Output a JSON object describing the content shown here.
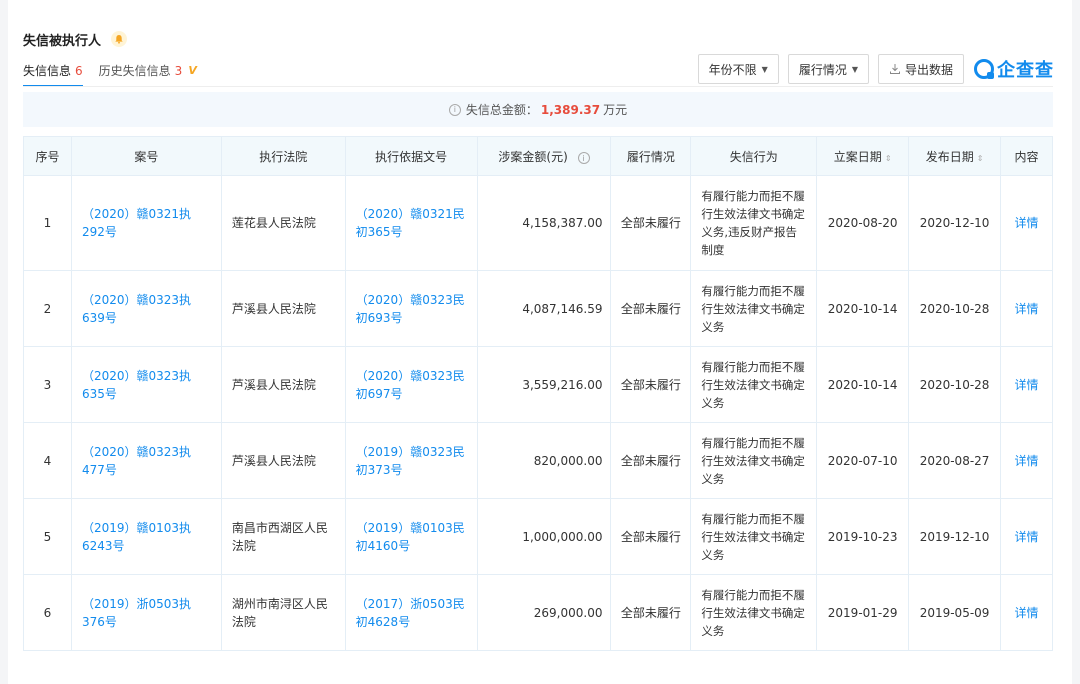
{
  "section": {
    "title": "失信被执行人"
  },
  "tabs": [
    {
      "label": "失信信息",
      "count": "6"
    },
    {
      "label": "历史失信信息",
      "count": "3",
      "badge": "V"
    }
  ],
  "toolbar": {
    "year_filter": "年份不限",
    "status_filter": "履行情况",
    "export_label": "导出数据",
    "logo_text": "企查查"
  },
  "summary": {
    "label": "失信总金额：",
    "amount": "1,389.37",
    "unit": "万元"
  },
  "table": {
    "headers": [
      "序号",
      "案号",
      "执行法院",
      "执行依据文号",
      "涉案金额(元)",
      "履行情况",
      "失信行为",
      "立案日期",
      "发布日期",
      "内容"
    ],
    "rows": [
      {
        "no": "1",
        "case": "（2020）赣0321执292号",
        "court": "莲花县人民法院",
        "basis": "（2020）赣0321民初365号",
        "amount": "4,158,387.00",
        "status": "全部未履行",
        "behavior": "有履行能力而拒不履行生效法律文书确定义务,违反财产报告制度",
        "filed": "2020-08-20",
        "published": "2020-12-10",
        "detail": "详情"
      },
      {
        "no": "2",
        "case": "（2020）赣0323执639号",
        "court": "芦溪县人民法院",
        "basis": "（2020）赣0323民初693号",
        "amount": "4,087,146.59",
        "status": "全部未履行",
        "behavior": "有履行能力而拒不履行生效法律文书确定义务",
        "filed": "2020-10-14",
        "published": "2020-10-28",
        "detail": "详情"
      },
      {
        "no": "3",
        "case": "（2020）赣0323执635号",
        "court": "芦溪县人民法院",
        "basis": "（2020）赣0323民初697号",
        "amount": "3,559,216.00",
        "status": "全部未履行",
        "behavior": "有履行能力而拒不履行生效法律文书确定义务",
        "filed": "2020-10-14",
        "published": "2020-10-28",
        "detail": "详情"
      },
      {
        "no": "4",
        "case": "（2020）赣0323执477号",
        "court": "芦溪县人民法院",
        "basis": "（2019）赣0323民初373号",
        "amount": "820,000.00",
        "status": "全部未履行",
        "behavior": "有履行能力而拒不履行生效法律文书确定义务",
        "filed": "2020-07-10",
        "published": "2020-08-27",
        "detail": "详情"
      },
      {
        "no": "5",
        "case": "（2019）赣0103执6243号",
        "court": "南昌市西湖区人民法院",
        "basis": "（2019）赣0103民初4160号",
        "amount": "1,000,000.00",
        "status": "全部未履行",
        "behavior": "有履行能力而拒不履行生效法律文书确定义务",
        "filed": "2019-10-23",
        "published": "2019-12-10",
        "detail": "详情"
      },
      {
        "no": "6",
        "case": "（2019）浙0503执376号",
        "court": "湖州市南浔区人民法院",
        "basis": "（2017）浙0503民初4628号",
        "amount": "269,000.00",
        "status": "全部未履行",
        "behavior": "有履行能力而拒不履行生效法律文书确定义务",
        "filed": "2019-01-29",
        "published": "2019-05-09",
        "detail": "详情"
      }
    ]
  }
}
